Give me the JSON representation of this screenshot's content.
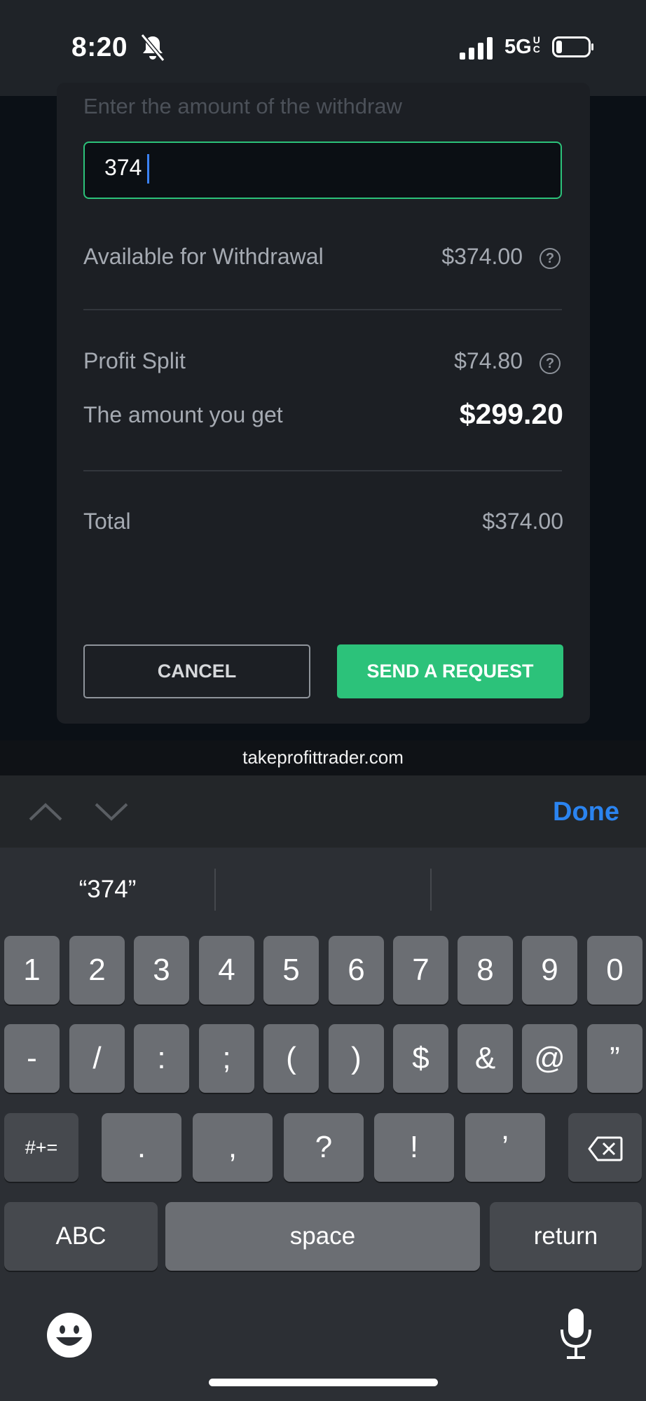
{
  "status_bar": {
    "time": "8:20",
    "network": "5G",
    "network_suffix": "UC"
  },
  "modal": {
    "amount_label": "Enter the amount of the withdraw",
    "amount_value": "374",
    "available_label": "Available for Withdrawal",
    "available_value": "$374.00",
    "profit_split_label": "Profit Split",
    "profit_split_value": "$74.80",
    "amount_get_label": "The amount you get",
    "amount_get_value": "$299.20",
    "total_label": "Total",
    "total_value": "$374.00",
    "help_glyph": "?",
    "cancel_label": "CANCEL",
    "send_label": "SEND A REQUEST",
    "accent_color": "#2cc27a"
  },
  "browser": {
    "url": "takeprofittrader.com"
  },
  "accessory_bar": {
    "done_label": "Done"
  },
  "keyboard": {
    "suggestion": "“374”",
    "row1": [
      "1",
      "2",
      "3",
      "4",
      "5",
      "6",
      "7",
      "8",
      "9",
      "0"
    ],
    "row2": [
      "-",
      "/",
      ":",
      ";",
      "(",
      ")",
      "$",
      "&",
      "@",
      "”"
    ],
    "row3": [
      ".",
      ",",
      "?",
      "!",
      "’"
    ],
    "mode_key": "#+=",
    "abc_key": "ABC",
    "space_key": "space",
    "return_key": "return",
    "icons": [
      "backspace-icon",
      "emoji-icon",
      "microphone-icon"
    ]
  }
}
